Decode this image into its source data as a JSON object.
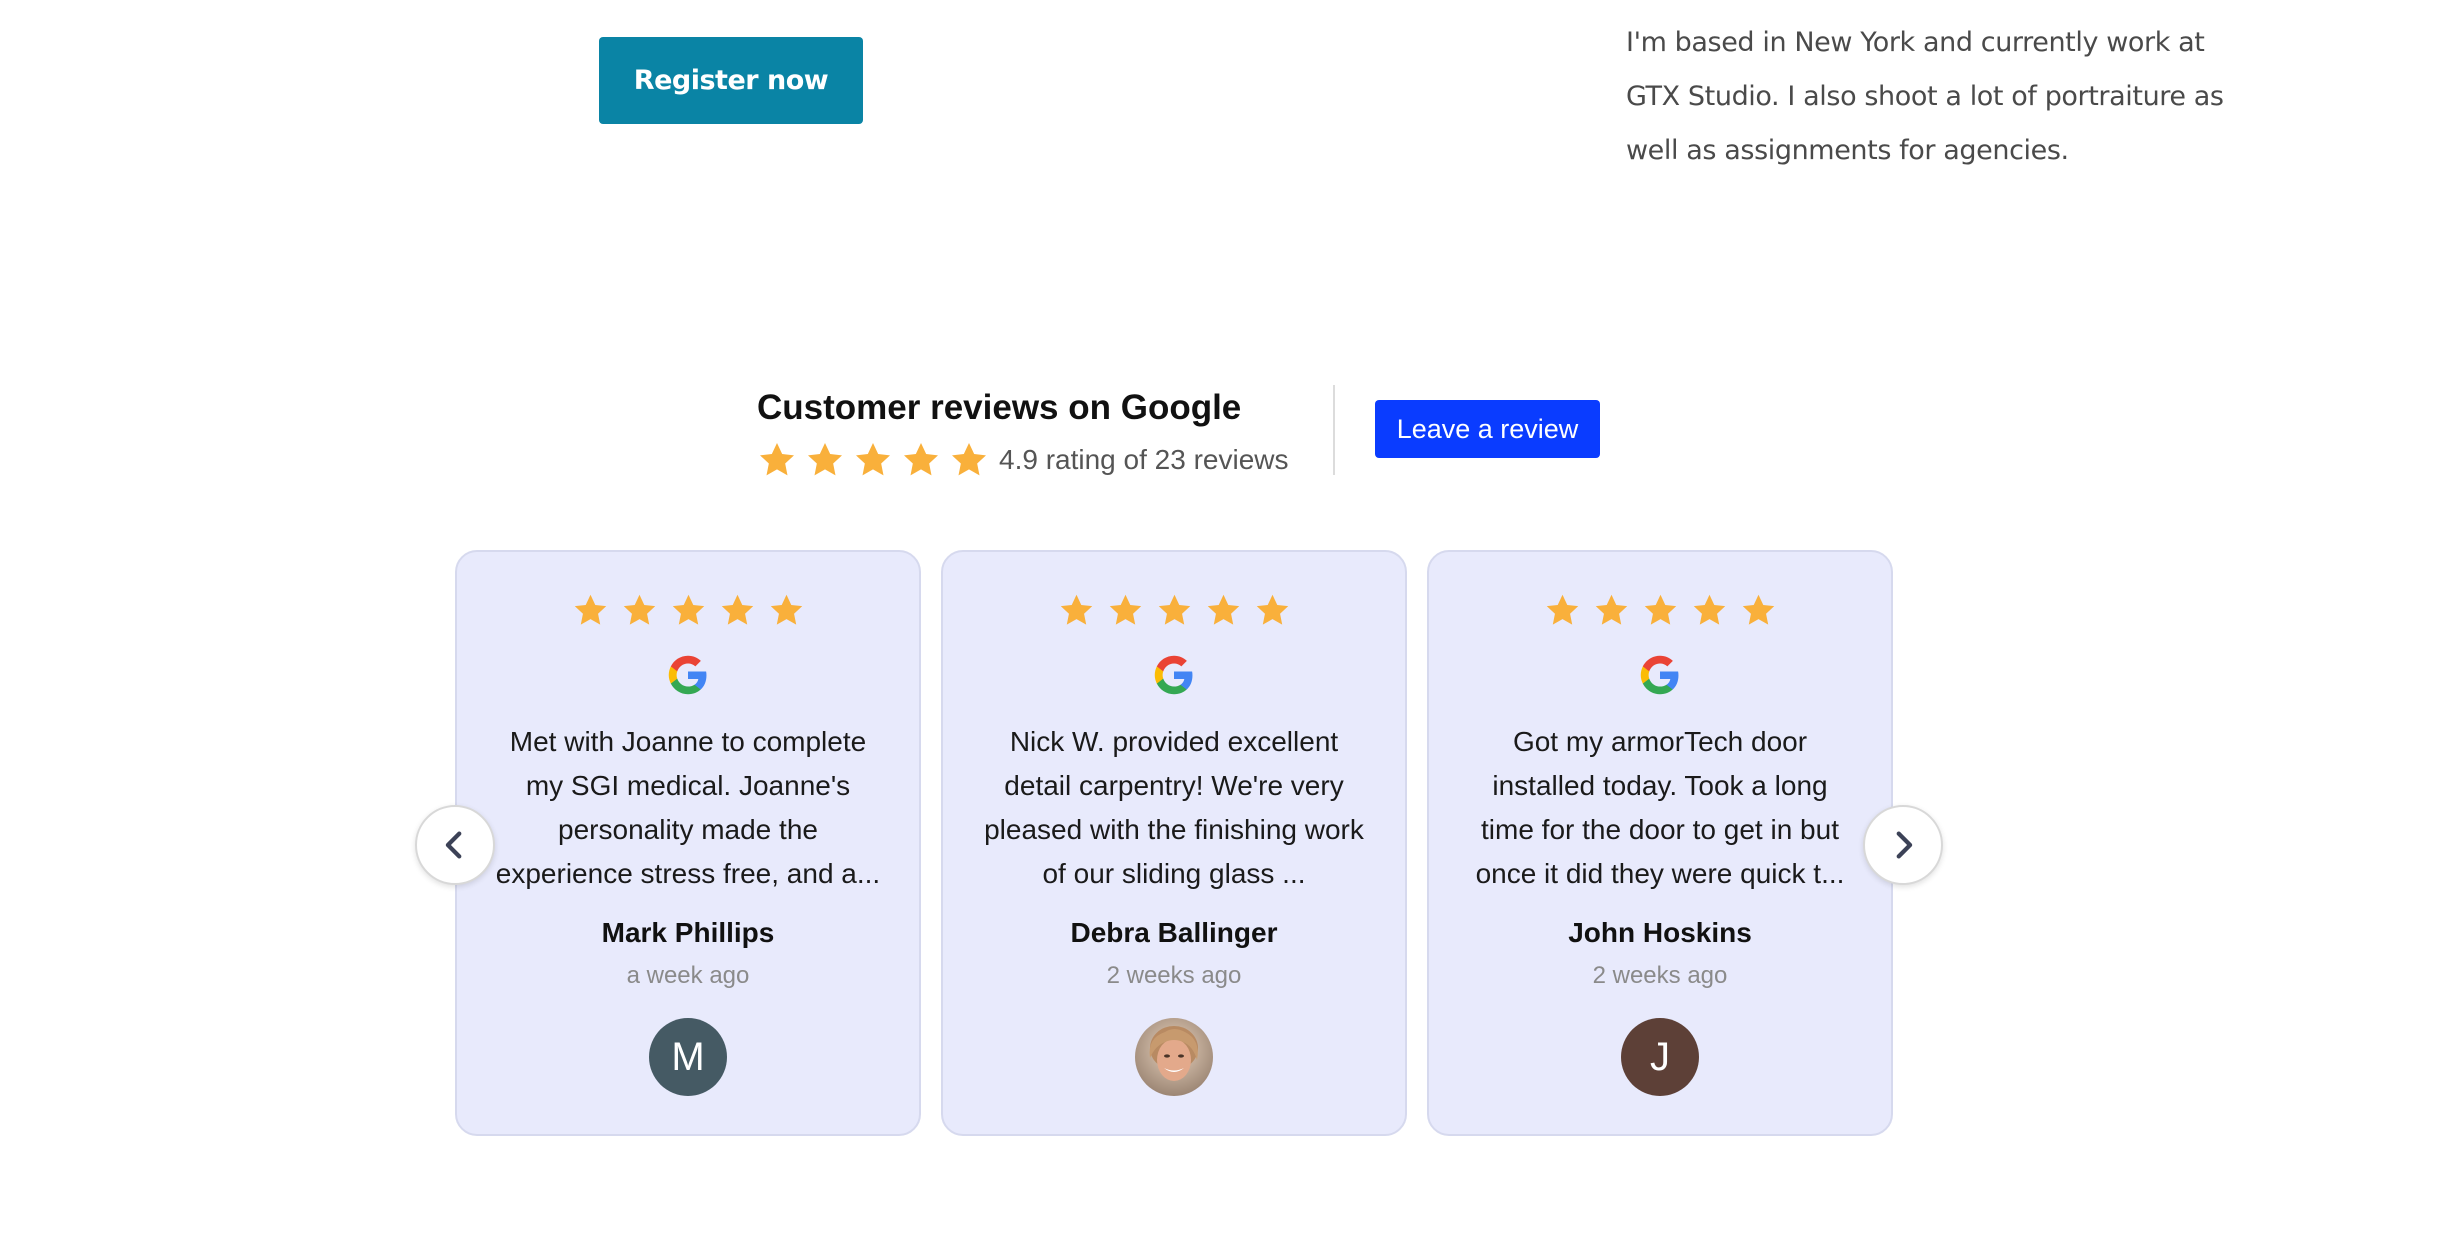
{
  "register_button": {
    "label": "Register now",
    "color": "#0a84a5"
  },
  "bio": {
    "text": "I'm based in New York and currently work at GTX Studio. I also shoot a lot of portraiture as well as assignments for agencies."
  },
  "reviews_widget": {
    "title": "Customer reviews on Google",
    "rating_text": "4.9 rating of 23 reviews",
    "rating": 4.9,
    "review_count": 23,
    "star_color": "#f9b03b",
    "leave_review_label": "Leave a review",
    "leave_review_color": "#0a3cff",
    "nav": {
      "prev_icon": "chevron-left-icon",
      "next_icon": "chevron-right-icon"
    },
    "reviews": [
      {
        "stars": 5,
        "source_icon": "google-g-icon",
        "text": "Met with Joanne to complete my SGI medical. Joanne's personality made the experience stress free, and a...",
        "name": "Mark Phillips",
        "time": "a week ago",
        "avatar_initial": "M",
        "avatar_color": "#455a64"
      },
      {
        "stars": 5,
        "source_icon": "google-g-icon",
        "text": "Nick W. provided excellent detail carpentry!   We're very pleased with the finishing work of our sliding glass ...",
        "name": "Debra Ballinger",
        "time": "2 weeks ago",
        "avatar_initial": "",
        "avatar_color": "#c9a389"
      },
      {
        "stars": 5,
        "source_icon": "google-g-icon",
        "text": "Got my armorTech door installed today. Took a long time for the door to get in but once it did they were quick t...",
        "name": "John Hoskins",
        "time": "2 weeks ago",
        "avatar_initial": "J",
        "avatar_color": "#5d4037"
      }
    ]
  }
}
